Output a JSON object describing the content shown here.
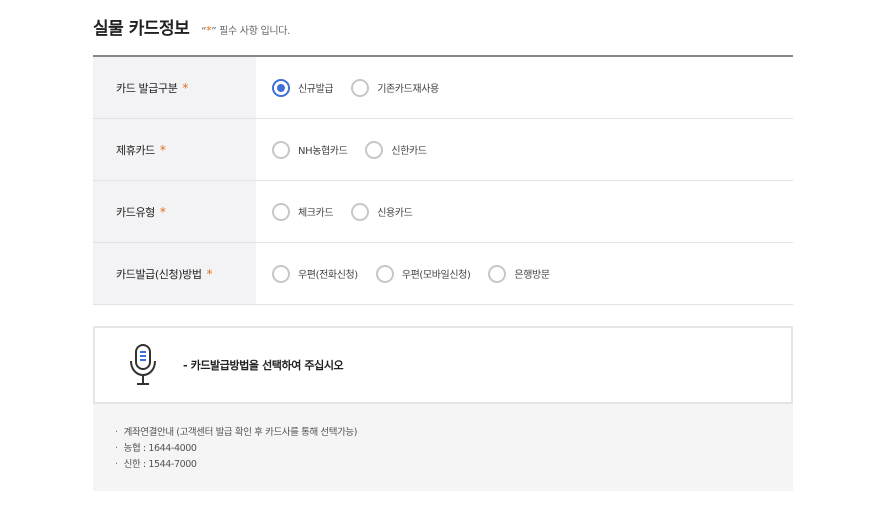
{
  "header": {
    "title": "실물 카드정보",
    "required_note_prefix": "“",
    "required_star": "*",
    "required_note_suffix": "” 필수 사항 입니다."
  },
  "form": {
    "rows": [
      {
        "label": "카드 발급구분",
        "star": "*",
        "options": [
          {
            "label": "신규발급",
            "checked": true
          },
          {
            "label": "기존카드재사용",
            "checked": false
          }
        ]
      },
      {
        "label": "제휴카드",
        "star": "*",
        "options": [
          {
            "label": "NH농협카드",
            "checked": false
          },
          {
            "label": "신한카드",
            "checked": false
          }
        ]
      },
      {
        "label": "카드유형",
        "star": "*",
        "options": [
          {
            "label": "체크카드",
            "checked": false
          },
          {
            "label": "신용카드",
            "checked": false
          }
        ]
      },
      {
        "label": "카드발급(신청)방법",
        "star": "*",
        "options": [
          {
            "label": "우편(전화신청)",
            "checked": false
          },
          {
            "label": "우편(모바일신청)",
            "checked": false
          },
          {
            "label": "은행방문",
            "checked": false
          }
        ]
      }
    ]
  },
  "notice": {
    "icon": "microphone-icon",
    "text": "- 카드발급방법을 선택하여 주십시오"
  },
  "info": {
    "items": [
      "계좌연결안내 (고객센터 발급 확인 후 카드사를 통해 선택가능)",
      "농협 : 1644-4000",
      "신한 : 1544-7000"
    ]
  },
  "colors": {
    "accent": "#3f6fd8",
    "required": "#e07020"
  }
}
